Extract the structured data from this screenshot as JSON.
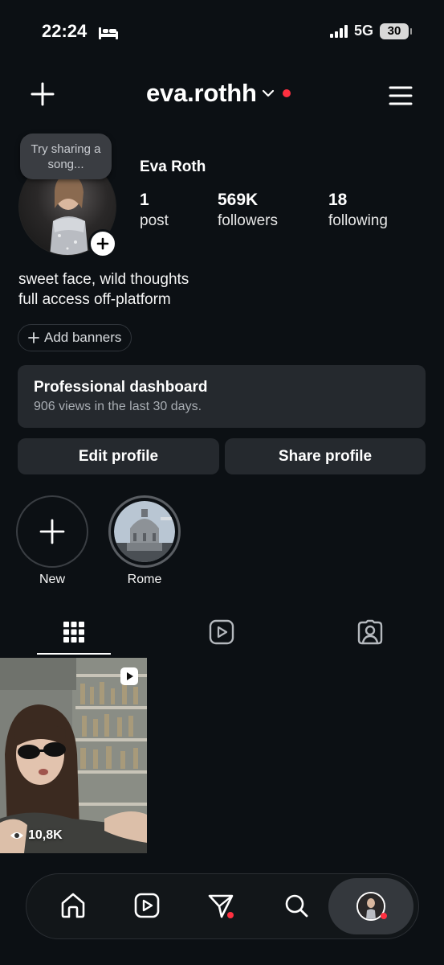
{
  "status_bar": {
    "time": "22:24",
    "network": "5G",
    "battery": "30",
    "icons": [
      "sleep-focus-icon",
      "signal-icon",
      "battery-icon"
    ]
  },
  "header": {
    "username": "eva.rothh",
    "icons": [
      "plus-icon",
      "chevron-down-icon",
      "notification-dot",
      "hamburger-menu-icon"
    ]
  },
  "profile": {
    "note_bubble": "Try sharing a song...",
    "display_name": "Eva Roth",
    "stats": [
      {
        "value": "1",
        "label": "post"
      },
      {
        "value": "569K",
        "label": "followers"
      },
      {
        "value": "18",
        "label": "following"
      }
    ],
    "bio": [
      "sweet face, wild thoughts",
      "full access off-platform"
    ],
    "add_banners": "Add banners"
  },
  "dashboard": {
    "title": "Professional dashboard",
    "subtitle": "906 views in the last 30 days."
  },
  "buttons": {
    "edit_profile": "Edit profile",
    "share_profile": "Share profile"
  },
  "highlights": [
    {
      "label": "New"
    },
    {
      "label": "Rome"
    }
  ],
  "tabs": {
    "items": [
      "grid-icon",
      "reels-icon",
      "tagged-icon"
    ],
    "active": "grid-icon"
  },
  "posts": [
    {
      "views": "10,8K",
      "type": "reel"
    }
  ],
  "bottom_nav": {
    "items": [
      "home-icon",
      "reels-icon",
      "direct-messages-icon",
      "search-icon",
      "profile-avatar"
    ],
    "active": "profile-avatar"
  },
  "colors": {
    "background": "#0c1014",
    "card": "#25292e",
    "notification": "#ff3040"
  }
}
